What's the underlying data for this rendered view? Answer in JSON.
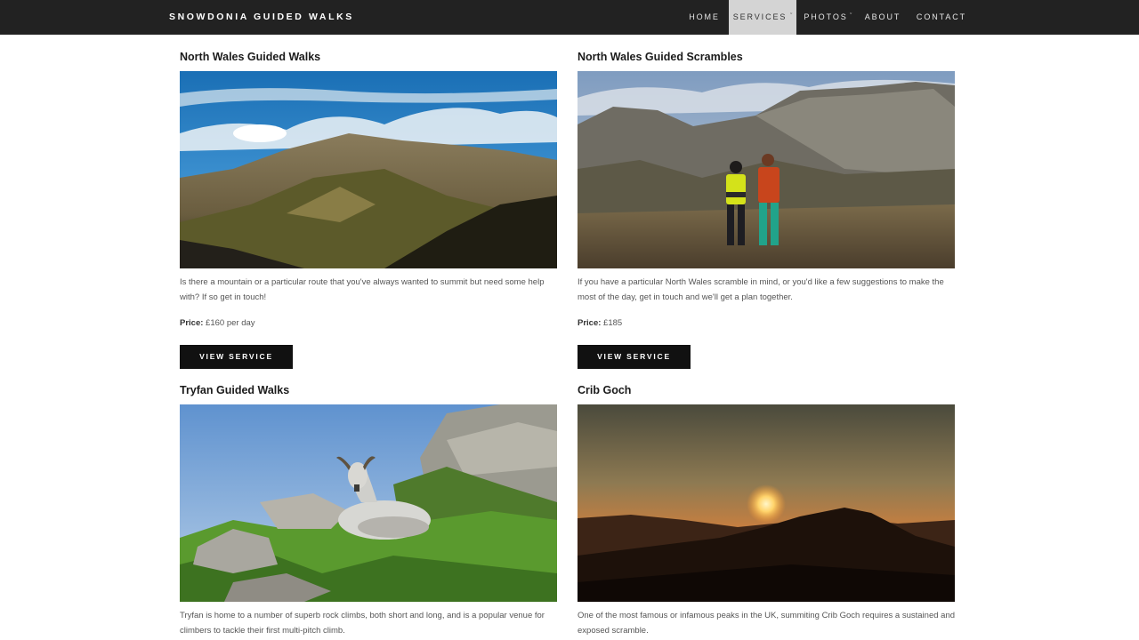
{
  "nav": {
    "brand": "SNOWDONIA GUIDED WALKS",
    "items": [
      {
        "label": "HOME",
        "active": false,
        "dropdown": false
      },
      {
        "label": "SERVICES",
        "active": true,
        "dropdown": true
      },
      {
        "label": "PHOTOS",
        "active": false,
        "dropdown": true
      },
      {
        "label": "ABOUT",
        "active": false,
        "dropdown": false
      },
      {
        "label": "CONTACT",
        "active": false,
        "dropdown": false
      }
    ],
    "dropdown_caret": "ˇ"
  },
  "services": [
    {
      "title": "North Wales Guided Walks",
      "image": "mountain-ridge-photo",
      "description": "Is there a mountain or a particular route that you've always wanted to summit but need some help with? If so get in touch!",
      "price_label": "Price:",
      "price_value": " £160 per day",
      "button_label": "VIEW SERVICE"
    },
    {
      "title": "North Wales Guided Scrambles",
      "image": "two-hikers-photo",
      "description": "If you have a particular North Wales scramble in mind, or you'd like a few suggestions to make the most of the day, get in touch and we'll get a plan together.",
      "price_label": "Price:",
      "price_value": " £185",
      "button_label": "VIEW SERVICE"
    },
    {
      "title": "Tryfan Guided Walks",
      "image": "mountain-goat-photo",
      "description": "Tryfan is home to a number of superb rock climbs, both short and long, and is a popular venue for climbers to tackle their first multi-pitch climb."
    },
    {
      "title": "Crib Goch",
      "image": "sunset-peak-photo",
      "description": "One of the most famous or infamous peaks in the UK, summiting Crib Goch requires a sustained and exposed scramble."
    }
  ],
  "colors": {
    "nav_bg": "#222222",
    "nav_active_bg": "#d4d4d4",
    "button_bg": "#111111"
  }
}
